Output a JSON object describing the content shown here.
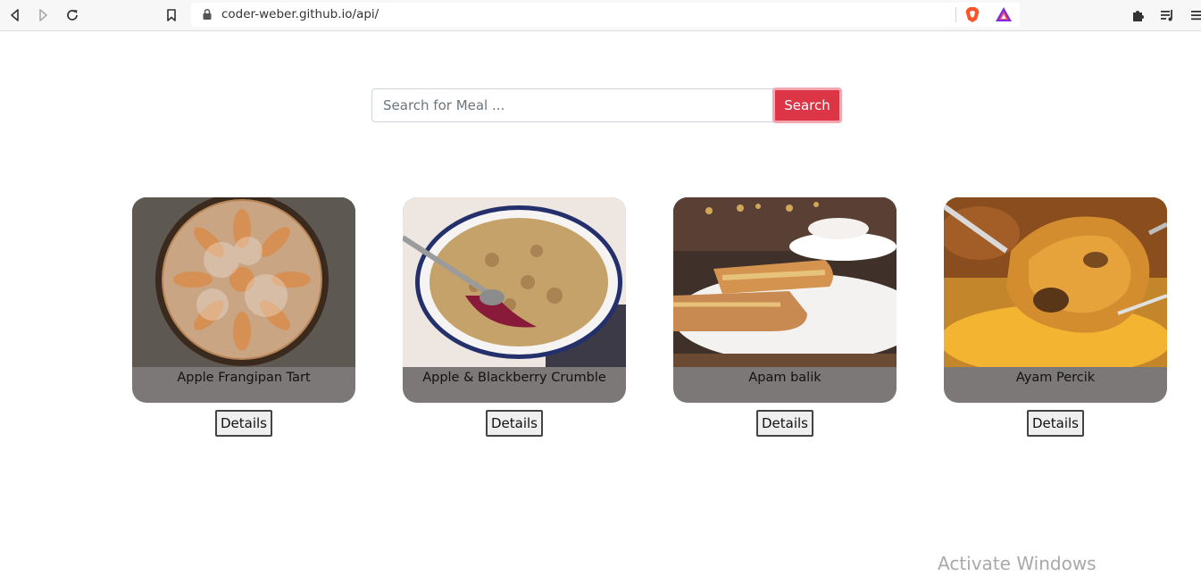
{
  "browser": {
    "url": "coder-weber.github.io/api/",
    "icons": {
      "back": "back-arrow-icon",
      "forward": "forward-arrow-icon",
      "reload": "reload-icon",
      "bookmark": "bookmark-icon",
      "lock": "lock-icon",
      "brave": "brave-shield-icon",
      "rewards": "brave-rewards-icon",
      "extensions": "puzzle-icon",
      "playlist": "playlist-icon",
      "menu": "menu-icon"
    }
  },
  "search": {
    "placeholder": "Search for Meal ...",
    "value": "",
    "button_label": "Search",
    "button_color": "#dc3545"
  },
  "meals": [
    {
      "name": "Apple Frangipan Tart",
      "details_label": "Details"
    },
    {
      "name": "Apple & Blackberry Crumble",
      "details_label": "Details"
    },
    {
      "name": "Apam balik",
      "details_label": "Details"
    },
    {
      "name": "Ayam Percik",
      "details_label": "Details"
    }
  ],
  "watermark": "Activate Windows",
  "colors": {
    "card_caption_bg": "#7d7878",
    "accent": "#dc3545"
  }
}
